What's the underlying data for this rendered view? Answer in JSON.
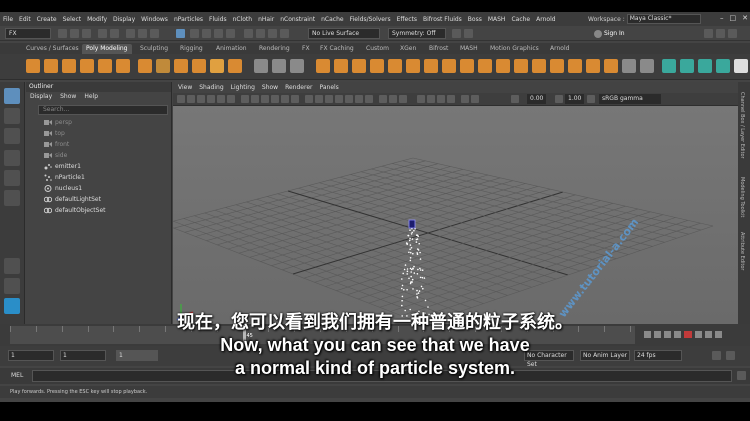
{
  "menubar": {
    "items": [
      "File",
      "Edit",
      "Create",
      "Select",
      "Modify",
      "Display",
      "Windows",
      "nParticles",
      "Fluids",
      "nCloth",
      "nHair",
      "nConstraint",
      "nCache",
      "Fields/Solvers",
      "Effects",
      "Bifrost Fluids",
      "Boss",
      "MASH",
      "Cache",
      "Arnold"
    ],
    "workspace_label": "Workspace :",
    "workspace_value": "Maya Classic*"
  },
  "statusline": {
    "menu_set": "FX",
    "live_surface": "No Live Surface",
    "symmetry": "Symmetry: Off",
    "sign_in": "Sign In"
  },
  "shelf_tabs": [
    "Curves / Surfaces",
    "Poly Modeling",
    "Sculpting",
    "Rigging",
    "Animation",
    "Rendering",
    "FX",
    "FX Caching",
    "Custom",
    "XGen",
    "Bifrost",
    "MASH",
    "Motion Graphics",
    "Arnold"
  ],
  "shelf_active": "Poly Modeling",
  "shelf_colors": {
    "orange": "#d98a32",
    "teal": "#3aa89c",
    "gray": "#8a8a8a",
    "white": "#dddddd"
  },
  "outliner": {
    "title": "Outliner",
    "menu": [
      "Display",
      "Show",
      "Help"
    ],
    "search_placeholder": "Search...",
    "items": [
      {
        "label": "persp",
        "icon": "camera-icon",
        "dim": true
      },
      {
        "label": "top",
        "icon": "camera-icon",
        "dim": true
      },
      {
        "label": "front",
        "icon": "camera-icon",
        "dim": true
      },
      {
        "label": "side",
        "icon": "camera-icon",
        "dim": true
      },
      {
        "label": "emitter1",
        "icon": "emitter-icon",
        "dim": false
      },
      {
        "label": "nParticle1",
        "icon": "particle-icon",
        "dim": false
      },
      {
        "label": "nucleus1",
        "icon": "nucleus-icon",
        "dim": false
      },
      {
        "label": "defaultLightSet",
        "icon": "set-icon",
        "dim": false
      },
      {
        "label": "defaultObjectSet",
        "icon": "set-icon",
        "dim": false
      }
    ]
  },
  "viewport": {
    "menu": [
      "View",
      "Shading",
      "Lighting",
      "Show",
      "Renderer",
      "Panels"
    ],
    "exposure": "0.00",
    "gamma": "1.00",
    "color_space": "sRGB gamma"
  },
  "right_labels": [
    "Channel Box / Layer Editor",
    "Modeling Toolkit",
    "Attribute Editor"
  ],
  "timeslider": {
    "current_frame": "45",
    "fps": "24 fps",
    "anim_layer": "No Anim Layer",
    "character_set": "No Character Set"
  },
  "range": {
    "start": "1",
    "current": "1",
    "field3": "1"
  },
  "cmdline": {
    "label": "MEL"
  },
  "helpline": "Play forwards. Pressing the ESC key will stop playback.",
  "subtitles": {
    "chinese": "现在，您可以看到我们拥有一种普通的粒子系统。",
    "english_line1": "Now, what you can see that we have",
    "english_line2": "a normal kind of particle system."
  },
  "watermark": "www.tutorial-a.com"
}
